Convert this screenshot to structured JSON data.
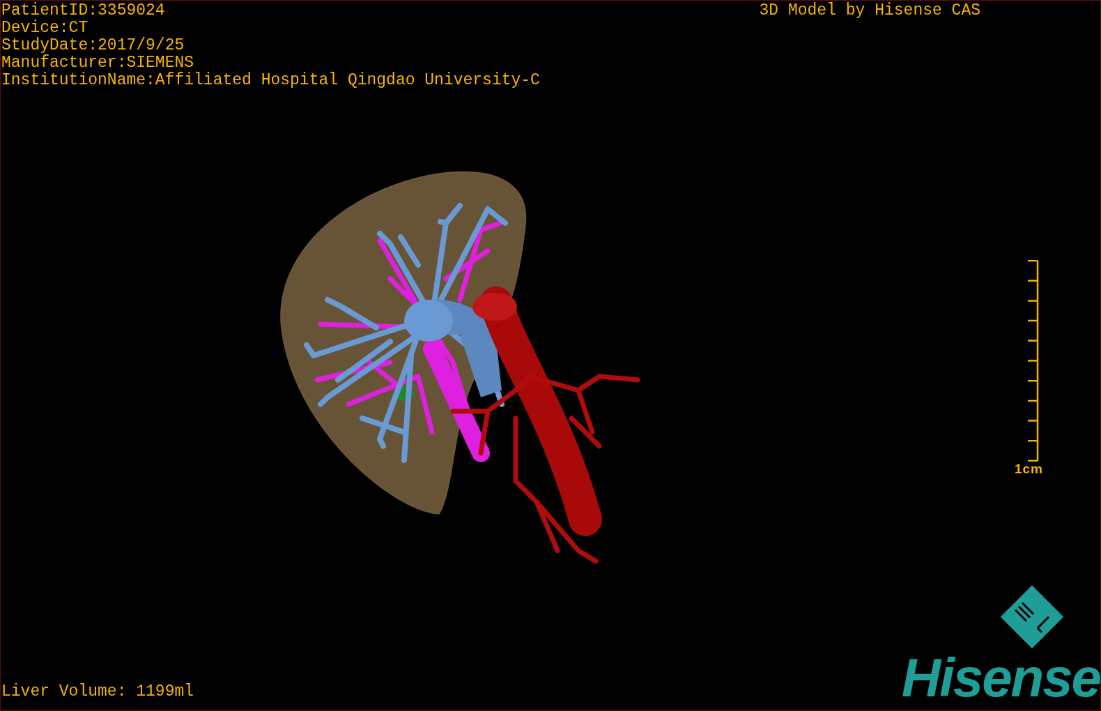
{
  "info_lines": [
    "PatientID:3359024",
    "Device:CT",
    "StudyDate:2017/9/25",
    "Manufacturer:SIEMENS",
    "InstitutionName:Affiliated Hospital Qingdao University-C"
  ],
  "caption": "3D Model by Hisense CAS",
  "scale_bar": {
    "label": "1cm"
  },
  "liver_volume": "Liver Volume: 1199ml",
  "logo": {
    "text": "Hisense"
  }
}
